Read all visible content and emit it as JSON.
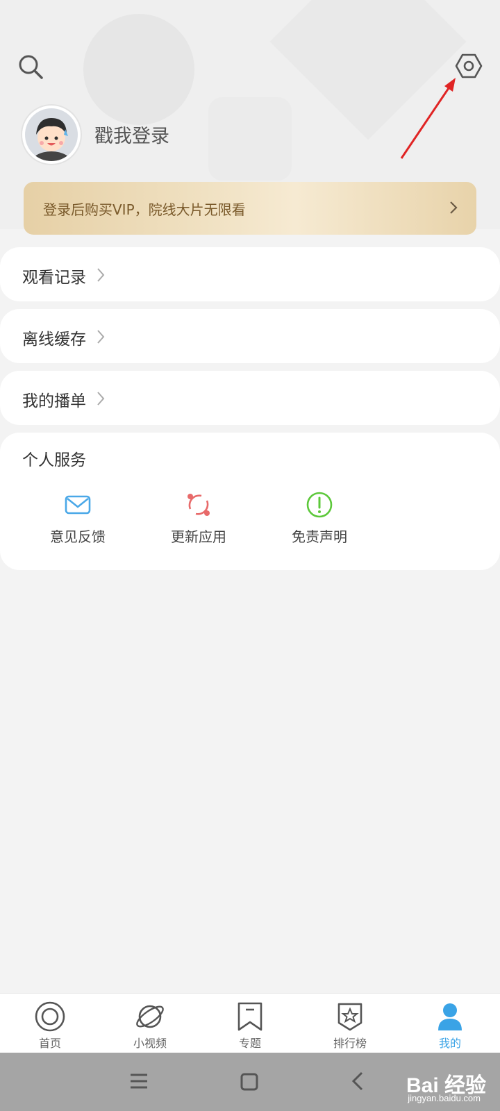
{
  "header": {
    "login_prompt": "戳我登录"
  },
  "vip_banner": {
    "text": "登录后购买VIP，院线大片无限看"
  },
  "menu": {
    "watch_history": "观看记录",
    "offline_cache": "离线缓存",
    "my_playlist": "我的播单"
  },
  "personal_services": {
    "title": "个人服务",
    "items": [
      {
        "label": "意见反馈",
        "icon": "envelope-icon",
        "color": "#4aa8e8"
      },
      {
        "label": "更新应用",
        "icon": "refresh-icon",
        "color": "#e86a6a"
      },
      {
        "label": "免责声明",
        "icon": "exclamation-icon",
        "color": "#5cc83a"
      }
    ]
  },
  "bottom_nav": {
    "items": [
      {
        "label": "首页",
        "icon": "home-circle-icon"
      },
      {
        "label": "小视频",
        "icon": "planet-icon"
      },
      {
        "label": "专题",
        "icon": "bookmark-icon"
      },
      {
        "label": "排行榜",
        "icon": "star-badge-icon"
      },
      {
        "label": "我的",
        "icon": "person-icon",
        "active": true
      }
    ]
  },
  "watermark": {
    "brand": "Bai 经验",
    "url": "jingyan.baidu.com"
  },
  "colors": {
    "accent": "#3aa3e6",
    "annotation_arrow": "#e02424",
    "vip_gold": "#e6d0a6"
  }
}
